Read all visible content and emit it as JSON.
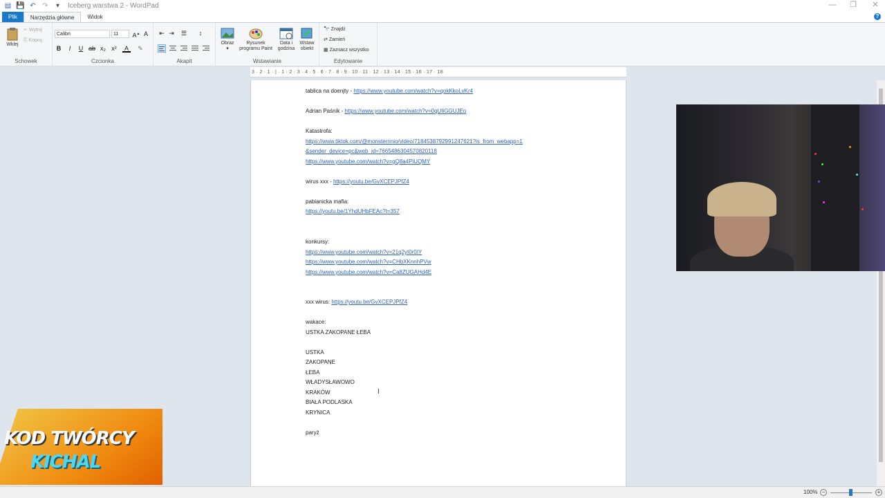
{
  "window": {
    "title": "Iceberg warstwa 2 - WordPad",
    "controls": {
      "minimize": "—",
      "restore": "❐",
      "close": "✕"
    }
  },
  "tabs": [
    {
      "label": "Plik"
    },
    {
      "label": "Narzędzia główne"
    },
    {
      "label": "Widok"
    }
  ],
  "ribbon": {
    "clipboard": {
      "paste": "Wklej",
      "cut": "Wytnij",
      "copy": "Kopiuj",
      "label": "Schowek"
    },
    "font": {
      "family": "Calibri",
      "size": "11",
      "label": "Czcionka"
    },
    "paragraph": {
      "label": "Akapit"
    },
    "insert": {
      "picture": "Obraz",
      "paint_1": "Rysunek",
      "paint_2": "programu Paint",
      "date_1": "Data i",
      "date_2": "godzina",
      "object_1": "Wstaw",
      "object_2": "obiekt",
      "label": "Wstawianie"
    },
    "editing": {
      "find": "Znajdź",
      "replace": "Zamień",
      "select_all": "Zaznacz wszystko",
      "label": "Edytowanie"
    }
  },
  "ruler": "3 · 2 · 1 · | · 1 · 2 · 3 · 4 · 5 · 6 · 7 · 8 · 9 · 10 · 11 · 12 · 13 · 14 · 15 · 16 · 17 · 18",
  "document": {
    "lines": [
      {
        "text": "tablica na doenjty - ",
        "link": "https://www.youtube.com/watch?v=qokKkoLvKr4"
      },
      {
        "text": "Adrian Paśnik - ",
        "link": "https://www.youtube.com/watch?v=0qUIiGGUJEo"
      },
      {
        "text": "Katastrofa:",
        "link": ""
      },
      {
        "text": "",
        "link": "https://www.tiktok.com/@monsterrinio/video/7184538792991247621?is_from_webapp=1"
      },
      {
        "text": "",
        "link": "&sender_device=pc&web_id=7665486304570820118"
      },
      {
        "text": "",
        "link": "https://www.youtube.com/watch?v=gQ8a4PiUQMY"
      },
      {
        "text": "wirus xxx - ",
        "link": "https://youtu.be/GvXCEPJPfZ4"
      },
      {
        "text": "pabianicka mafia:",
        "link": ""
      },
      {
        "text": "",
        "link": "https://youtu.be/1YhdUHbFEAc?t=357"
      },
      {
        "text": "konkursy:",
        "link": ""
      },
      {
        "text": "",
        "link": "https://www.youtube.com/watch?v=21q2yI0r0IY"
      },
      {
        "text": "",
        "link": "https://www.youtube.com/watch?v=CHbXKnnhPVw"
      },
      {
        "text": "",
        "link": "https://www.youtube.com/watch?v=Ca8ZUGAHd4E"
      },
      {
        "text": "xxx wirus: ",
        "link": "https://youtu.be/GvXCEPJPfZ4"
      },
      {
        "text": "wakace:",
        "link": ""
      },
      {
        "text": "USTKA ZAKOPANE ŁEBA",
        "link": ""
      },
      {
        "text": "USTKA",
        "link": ""
      },
      {
        "text": "ZAKOPANE",
        "link": ""
      },
      {
        "text": "ŁEBA",
        "link": ""
      },
      {
        "text": "WŁADYSŁAWOWO",
        "link": ""
      },
      {
        "text": "KRAKÓW",
        "link": ""
      },
      {
        "text": "BIAŁA PODLASKA",
        "link": ""
      },
      {
        "text": "KRYNICA",
        "link": ""
      },
      {
        "text": "paryż",
        "link": ""
      }
    ]
  },
  "overlay": {
    "line1": "KOD TWÓRCY",
    "line2": "KICHAL"
  },
  "status": {
    "zoom": "100%",
    "zoom_level_percent": 100
  }
}
